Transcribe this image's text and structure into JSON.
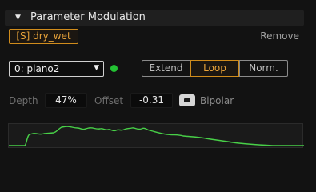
{
  "section": {
    "title": "Parameter Modulation",
    "expanded": true
  },
  "parameter": {
    "tag": "[S] dry_wet",
    "remove_label": "Remove"
  },
  "source": {
    "selected": "0: piano2",
    "active": true
  },
  "modes": {
    "options": [
      "Extend",
      "Loop",
      "Norm."
    ],
    "selected": "Loop"
  },
  "depth": {
    "label": "Depth",
    "value": "47%"
  },
  "offset": {
    "label": "Offset",
    "value": "-0.31"
  },
  "bipolar": {
    "label": "Bipolar",
    "enabled": true
  },
  "colors": {
    "accent": "#e8a33a",
    "active_dot": "#23c233",
    "envelope_line": "#48d048"
  }
}
